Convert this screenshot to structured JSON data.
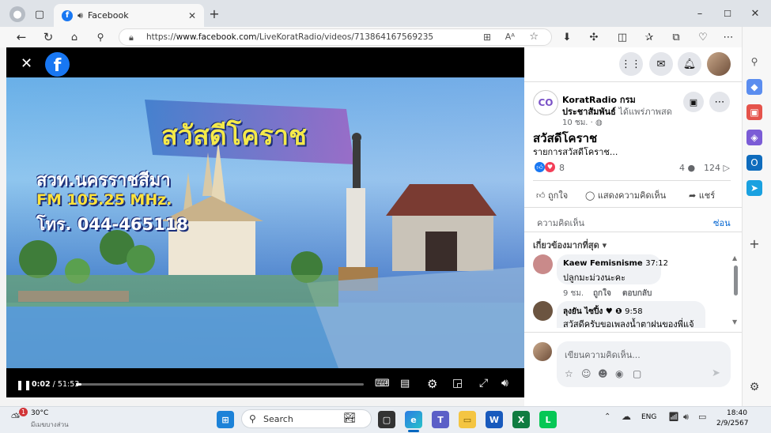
{
  "browser": {
    "tab_title": "Facebook",
    "new_tab_symbol": "+",
    "url_prefix": "https://",
    "url_host": "www.facebook.com",
    "url_path": "/LiveKoratRadio/videos/713864167569235",
    "window_controls": [
      "–",
      "☐",
      "✕"
    ]
  },
  "video": {
    "poster_title": "สวัสดีโคราช",
    "poster_line1": "สวท.นครราชสีมา",
    "poster_line2": "FM 105.25 MHz.",
    "poster_line3": "โทร. 044-465118",
    "time_current": "0:02",
    "time_separator": "/",
    "time_total": "51:53",
    "progress": 0.02
  },
  "post": {
    "page_name_line1": "KoratRadio กรม",
    "page_name_line2": "ประชาสัมพันธ์",
    "action_text": "ได้แพร่ภาพสด",
    "time": "10 ชม.",
    "privacy_symbol": "·",
    "title": "สวัสดีโคราช",
    "description": "รายการสวัสดีโคราช...",
    "reactions_count": "8",
    "comments_count": "4",
    "shares_count": "124",
    "like_label": "ถูกใจ",
    "comment_label": "แสดงความคิดเห็น",
    "share_label": "แชร์",
    "comments_header": "ความคิดเห็น",
    "hide_label": "ซ่อน",
    "sort_label": "เกี่ยวข้องมากที่สุด",
    "comment_placeholder": "เขียนความคิดเห็น..."
  },
  "comments": [
    {
      "author": "Kaew Femisnisme",
      "time_code": "37:12",
      "text": "ปลูกมะม่วงนะคะ",
      "age": "9 ชม.",
      "like": "ถูกใจ",
      "reply": "ตอบกลับ"
    },
    {
      "author": "ลุงยัน ไซปิ้ง",
      "badges": "♥ ❶",
      "time_code": "9:58",
      "text": "สวัสดีครับขอเพลงน้ำตาฝนของพี่แจ้"
    }
  ],
  "taskbar": {
    "weather_temp": "30°C",
    "weather_desc": "มีเมฆบางส่วน",
    "weather_badge": "1",
    "search_placeholder": "Search",
    "lang": "ENG",
    "clock_time": "18:40",
    "clock_date": "2/9/2567"
  },
  "colors": {
    "facebook_blue": "#1877f2",
    "accent_blue": "#0064d1"
  }
}
